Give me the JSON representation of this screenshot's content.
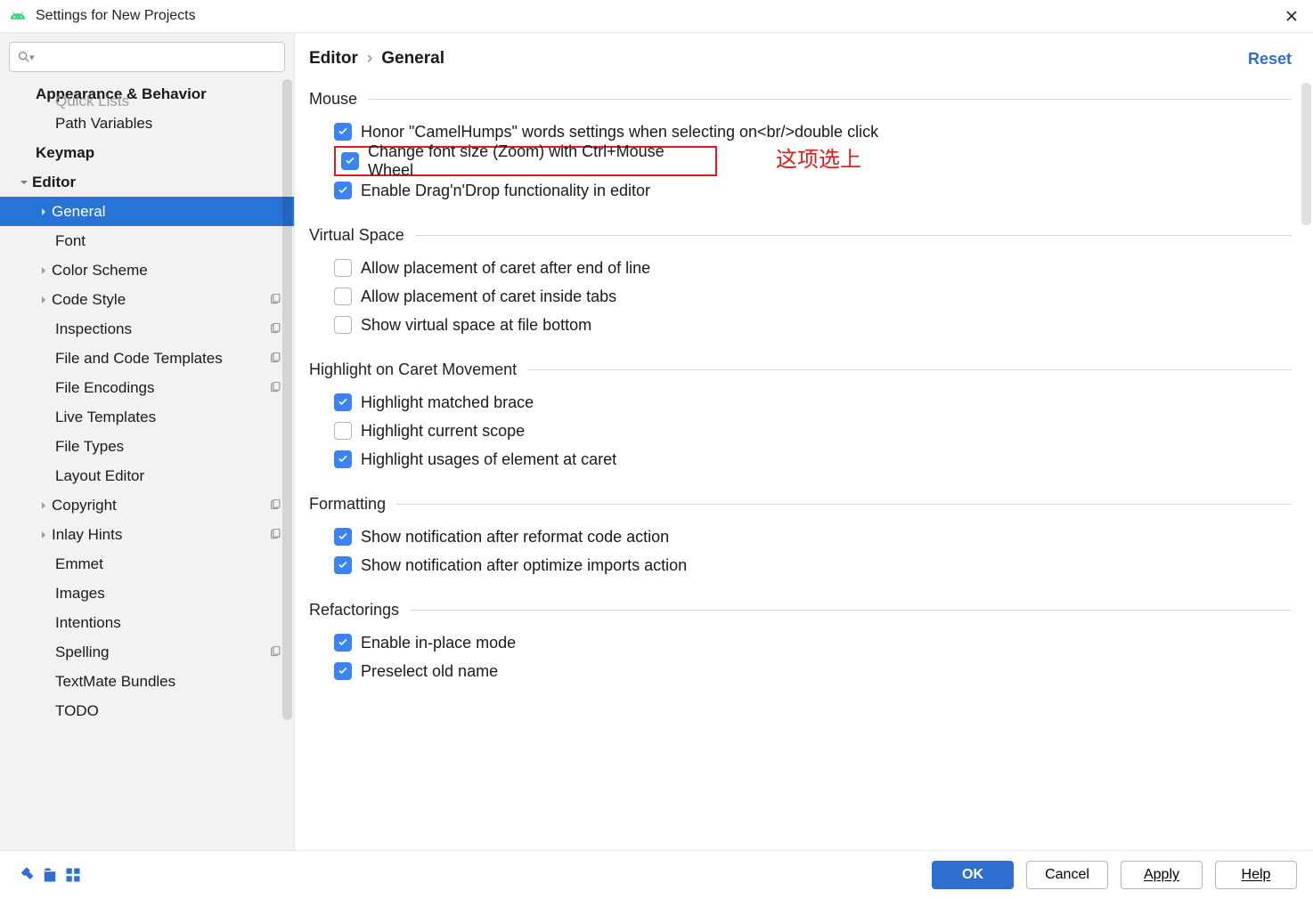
{
  "window": {
    "title": "Settings for New Projects"
  },
  "search": {
    "placeholder": ""
  },
  "sidebar": {
    "cutoff_label": "Quick Lists",
    "items": [
      {
        "label": "Appearance & Behavior",
        "bold": true,
        "indent": 40
      },
      {
        "label": "Path Variables",
        "indent": 62
      },
      {
        "label": "Keymap",
        "bold": true,
        "indent": 40
      },
      {
        "label": "Editor",
        "bold": true,
        "indent": 40,
        "expander": "down"
      },
      {
        "label": "General",
        "indent": 62,
        "selected": true,
        "expander": "right-sel"
      },
      {
        "label": "Font",
        "indent": 62
      },
      {
        "label": "Color Scheme",
        "indent": 62,
        "expander": "right"
      },
      {
        "label": "Code Style",
        "indent": 62,
        "expander": "right",
        "badge": true
      },
      {
        "label": "Inspections",
        "indent": 62,
        "badge": true
      },
      {
        "label": "File and Code Templates",
        "indent": 62,
        "badge": true
      },
      {
        "label": "File Encodings",
        "indent": 62,
        "badge": true
      },
      {
        "label": "Live Templates",
        "indent": 62
      },
      {
        "label": "File Types",
        "indent": 62
      },
      {
        "label": "Layout Editor",
        "indent": 62
      },
      {
        "label": "Copyright",
        "indent": 62,
        "expander": "right",
        "badge": true
      },
      {
        "label": "Inlay Hints",
        "indent": 62,
        "expander": "right",
        "badge": true
      },
      {
        "label": "Emmet",
        "indent": 62
      },
      {
        "label": "Images",
        "indent": 62
      },
      {
        "label": "Intentions",
        "indent": 62
      },
      {
        "label": "Spelling",
        "indent": 62,
        "badge": true
      },
      {
        "label": "TextMate Bundles",
        "indent": 62
      },
      {
        "label": "TODO",
        "indent": 62
      }
    ]
  },
  "breadcrumb": {
    "parent": "Editor",
    "current": "General"
  },
  "reset_label": "Reset",
  "sections": {
    "mouse": {
      "title": "Mouse",
      "opts": [
        {
          "label": "Honor \"CamelHumps\" words settings when selecting on<br/>double click",
          "checked": true
        },
        {
          "label": "Change font size (Zoom) with Ctrl+Mouse Wheel",
          "checked": true,
          "highlight": true
        },
        {
          "label": "Enable Drag'n'Drop functionality in editor",
          "checked": true
        }
      ],
      "annotation": "这项选上"
    },
    "virtual": {
      "title": "Virtual Space",
      "opts": [
        {
          "label": "Allow placement of caret after end of line",
          "checked": false
        },
        {
          "label": "Allow placement of caret inside tabs",
          "checked": false
        },
        {
          "label": "Show virtual space at file bottom",
          "checked": false
        }
      ]
    },
    "highlight": {
      "title": "Highlight on Caret Movement",
      "opts": [
        {
          "label": "Highlight matched brace",
          "checked": true
        },
        {
          "label": "Highlight current scope",
          "checked": false
        },
        {
          "label": "Highlight usages of element at caret",
          "checked": true
        }
      ]
    },
    "formatting": {
      "title": "Formatting",
      "opts": [
        {
          "label": "Show notification after reformat code action",
          "checked": true
        },
        {
          "label": "Show notification after optimize imports action",
          "checked": true
        }
      ]
    },
    "refactorings": {
      "title": "Refactorings",
      "opts": [
        {
          "label": "Enable in-place mode",
          "checked": true
        },
        {
          "label": "Preselect old name",
          "checked": true
        }
      ]
    }
  },
  "footer": {
    "ok": "OK",
    "cancel": "Cancel",
    "apply": "Apply",
    "help": "Help"
  }
}
